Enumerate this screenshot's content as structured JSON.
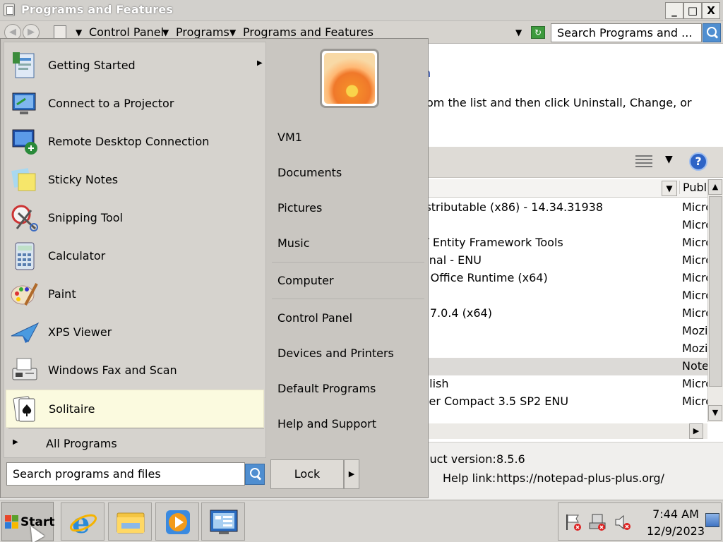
{
  "window": {
    "title": "Programs and Features",
    "min": "_",
    "max": "□",
    "close": "X"
  },
  "addressbar": {
    "breadcrumbs": [
      "Control Panel",
      "Programs",
      "Programs and Features"
    ],
    "search_placeholder": "Search Programs and ..."
  },
  "content": {
    "instruction": "om the list and then click Uninstall, Change, or",
    "column_publisher": "Publi",
    "rows": [
      {
        "name": "istributable (x86) - 14.34.31938",
        "publisher": "Micro",
        "selected": false
      },
      {
        "name": "",
        "publisher": "Micro",
        "selected": false
      },
      {
        "name": "T Entity Framework Tools",
        "publisher": "Micro",
        "selected": false
      },
      {
        "name": "onal - ENU",
        "publisher": "Micro",
        "selected": false
      },
      {
        "name": "r Office Runtime (x64)",
        "publisher": "Micro",
        "selected": false
      },
      {
        "name": "",
        "publisher": "Micro",
        "selected": false
      },
      {
        "name": "- 7.0.4 (x64)",
        "publisher": "Micro",
        "selected": false
      },
      {
        "name": "",
        "publisher": "Mozi",
        "selected": false
      },
      {
        "name": "",
        "publisher": "Mozi",
        "selected": false
      },
      {
        "name": "",
        "publisher": "Note",
        "selected": true
      },
      {
        "name": "glish",
        "publisher": "Micro",
        "selected": false
      },
      {
        "name": "ver Compact 3.5 SP2 ENU",
        "publisher": "Micro",
        "selected": false
      }
    ],
    "details": {
      "product_version_label": "luct version:",
      "product_version": "8.5.6",
      "help_link_label": "Help link:",
      "help_link": "https://notepad-plus-plus.org/"
    }
  },
  "startmenu": {
    "programs": [
      {
        "label": "Getting Started",
        "icon": "getting-started-icon",
        "submenu": true
      },
      {
        "label": "Connect to a Projector",
        "icon": "projector-icon",
        "submenu": false
      },
      {
        "label": "Remote Desktop Connection",
        "icon": "remote-desktop-icon",
        "submenu": false
      },
      {
        "label": "Sticky Notes",
        "icon": "sticky-notes-icon",
        "submenu": false
      },
      {
        "label": "Snipping Tool",
        "icon": "snipping-tool-icon",
        "submenu": false
      },
      {
        "label": "Calculator",
        "icon": "calculator-icon",
        "submenu": false
      },
      {
        "label": "Paint",
        "icon": "paint-icon",
        "submenu": false
      },
      {
        "label": "XPS Viewer",
        "icon": "xps-viewer-icon",
        "submenu": false
      },
      {
        "label": "Windows Fax and Scan",
        "icon": "fax-scan-icon",
        "submenu": false
      },
      {
        "label": "Solitaire",
        "icon": "solitaire-icon",
        "submenu": false,
        "selected": true
      }
    ],
    "all_programs": "All Programs",
    "search_placeholder": "Search programs and files",
    "right_links": {
      "user": "VM1",
      "documents": "Documents",
      "pictures": "Pictures",
      "music": "Music",
      "computer": "Computer",
      "control_panel": "Control Panel",
      "devices_printers": "Devices and Printers",
      "default_programs": "Default Programs",
      "help_support": "Help and Support"
    },
    "lock": "Lock"
  },
  "taskbar": {
    "start": "Start",
    "apps": [
      "internet-explorer-icon",
      "file-explorer-icon",
      "media-player-icon",
      "server-manager-icon"
    ],
    "clock_time": "7:44 AM",
    "clock_date": "12/9/2023"
  }
}
